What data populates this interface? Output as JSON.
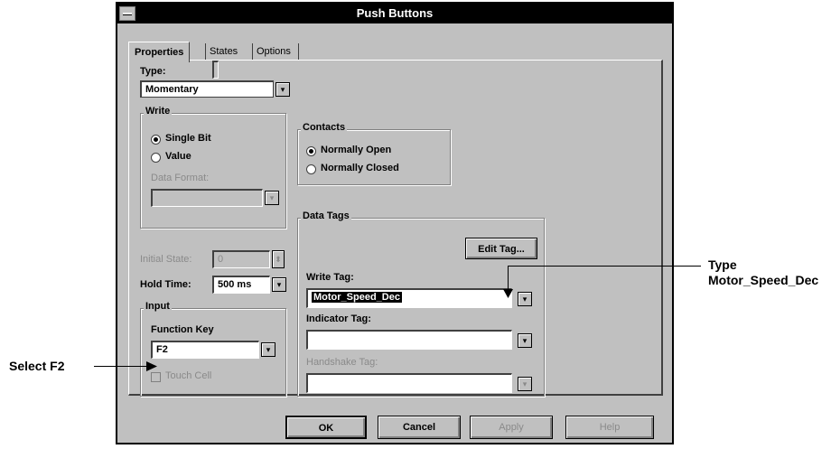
{
  "window": {
    "title": "Push Buttons"
  },
  "tabs": [
    {
      "label": "Properties"
    },
    {
      "label": "States"
    },
    {
      "label": "Options"
    }
  ],
  "type": {
    "label": "Type:",
    "value": "Momentary"
  },
  "write": {
    "group_label": "Write",
    "single_bit": "Single Bit",
    "value": "Value",
    "selected": "Single Bit",
    "data_format_label": "Data Format:",
    "data_format_value": ""
  },
  "contacts": {
    "group_label": "Contacts",
    "normally_open": "Normally Open",
    "normally_closed": "Normally Closed",
    "selected": "Normally Open"
  },
  "initial_state": {
    "label": "Initial State:",
    "value": "0"
  },
  "hold_time": {
    "label": "Hold Time:",
    "value": "500 ms"
  },
  "input": {
    "group_label": "Input",
    "function_key_label": "Function Key",
    "function_key_value": "F2",
    "touch_cell_label": "Touch Cell"
  },
  "data_tags": {
    "group_label": "Data Tags",
    "edit_tag_button": "Edit Tag...",
    "write_tag_label": "Write Tag:",
    "write_tag_value": "Motor_Speed_Dec",
    "indicator_tag_label": "Indicator Tag:",
    "indicator_tag_value": "",
    "handshake_tag_label": "Handshake Tag:",
    "handshake_tag_value": ""
  },
  "buttons": {
    "ok": "OK",
    "cancel": "Cancel",
    "apply": "Apply",
    "help": "Help"
  },
  "annotations": {
    "type_line1": "Type",
    "type_line2": "Motor_Speed_Dec",
    "select": "Select F2"
  },
  "icons": {
    "dropdown": "▾",
    "spin": "⬍"
  }
}
